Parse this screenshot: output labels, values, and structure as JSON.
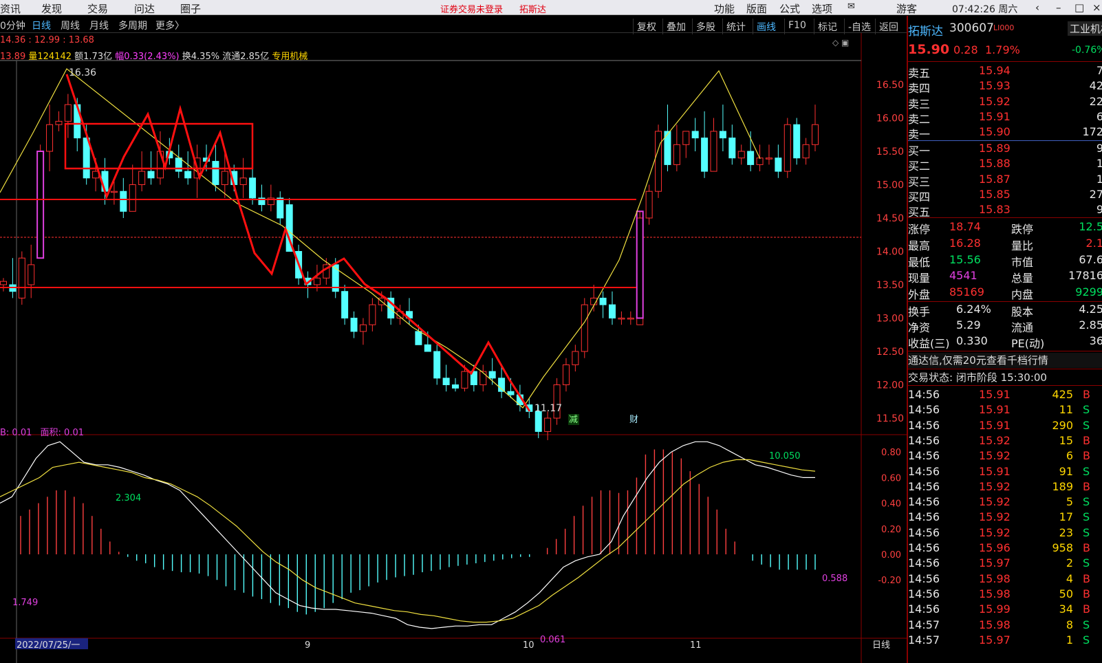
{
  "menubar": {
    "items": [
      "资讯",
      "发现",
      "交易",
      "问达",
      "圈子"
    ],
    "alert": "证券交易未登录",
    "alert_stock": "拓斯达",
    "right_items": [
      "功能",
      "版面",
      "公式",
      "选项"
    ],
    "guest": "游客",
    "time": "07:42:26 周六"
  },
  "toolbar": {
    "periods": [
      "0分钟",
      "日线",
      "周线",
      "月线",
      "多周期",
      "更多〉"
    ],
    "active_period": "日线",
    "right_buttons": [
      "复权",
      "叠加",
      "多股",
      "统计",
      "画线",
      "F10",
      "标记",
      "-自选",
      "返回"
    ],
    "active_button": "画线"
  },
  "info_line1": "14.36 : 12.99 : 13.68",
  "info_line2": {
    "a": "13.89",
    "vol": "量124142",
    "amt": "额1.73亿",
    "amp": "幅0.33(2.43%)",
    "turn": "换4.35%",
    "float": "流通2.85亿",
    "tag": "专用机械"
  },
  "annotations": {
    "high": "16.36",
    "low": "11.17",
    "mark_jian": "减",
    "mark_cai": "财"
  },
  "price_axis": [
    "16.50",
    "16.00",
    "15.50",
    "15.00",
    "14.50",
    "14.00",
    "13.50",
    "13.00",
    "12.50",
    "12.00",
    "11.50"
  ],
  "macd_header": {
    "b": "B: 0.01",
    "area": "面积: 0.01"
  },
  "macd_axis": [
    "0.80",
    "0.60",
    "0.40",
    "0.20",
    "0.00",
    "-0.20"
  ],
  "macd_labels": {
    "a": "2.304",
    "b": "1.749",
    "c": "10.050",
    "d": "0.588",
    "e": "0.061"
  },
  "date_axis": {
    "start": "2022/07/25/一",
    "m9": "9",
    "m10": "10",
    "m11": "11",
    "period": "日线"
  },
  "stock": {
    "name": "拓斯达",
    "code": "300607",
    "badge": "LI000",
    "sector": "工业机械",
    "sector_chg": "-0.76%",
    "price": "15.90",
    "chg": "0.28",
    "pct": "1.79%"
  },
  "asks": [
    {
      "label": "卖五",
      "price": "15.94",
      "vol": "7"
    },
    {
      "label": "卖四",
      "price": "15.93",
      "vol": "42"
    },
    {
      "label": "卖三",
      "price": "15.92",
      "vol": "22"
    },
    {
      "label": "卖二",
      "price": "15.91",
      "vol": "6"
    },
    {
      "label": "卖一",
      "price": "15.90",
      "vol": "172"
    }
  ],
  "bids": [
    {
      "label": "买一",
      "price": "15.89",
      "vol": "9"
    },
    {
      "label": "买二",
      "price": "15.88",
      "vol": "1"
    },
    {
      "label": "买三",
      "price": "15.87",
      "vol": "1"
    },
    {
      "label": "买四",
      "price": "15.85",
      "vol": "27"
    },
    {
      "label": "买五",
      "price": "15.83",
      "vol": "9"
    }
  ],
  "stats": [
    {
      "l1": "涨停",
      "v1": "18.74",
      "c1": "r",
      "l2": "跌停",
      "v2": "12.5",
      "c2": "g"
    },
    {
      "l1": "最高",
      "v1": "16.28",
      "c1": "r",
      "l2": "量比",
      "v2": "2.1",
      "c2": "r"
    },
    {
      "l1": "最低",
      "v1": "15.56",
      "c1": "g",
      "l2": "市值",
      "v2": "67.6",
      "c2": "w"
    },
    {
      "l1": "现量",
      "v1": "4541",
      "c1": "m",
      "l2": "总量",
      "v2": "17816",
      "c2": "w"
    },
    {
      "l1": "外盘",
      "v1": "85169",
      "c1": "r",
      "l2": "内盘",
      "v2": "9299",
      "c2": "g"
    }
  ],
  "stats2": [
    {
      "l1": "换手",
      "v1": "6.24%",
      "l2": "股本",
      "v2": "4.25"
    },
    {
      "l1": "净资",
      "v1": "5.29",
      "l2": "流通",
      "v2": "2.85"
    },
    {
      "l1": "收益(三)",
      "v1": "0.330",
      "l2": "PE(动)",
      "v2": "36"
    }
  ],
  "promo": "通达信,仅需20元查看千档行情",
  "trade_status": "交易状态: 闭市阶段 15:30:00",
  "ticks": [
    {
      "t": "14:56",
      "p": "15.91",
      "v": "425",
      "s": "B"
    },
    {
      "t": "14:56",
      "p": "15.91",
      "v": "11",
      "s": "S"
    },
    {
      "t": "14:56",
      "p": "15.91",
      "v": "290",
      "s": "S"
    },
    {
      "t": "14:56",
      "p": "15.92",
      "v": "15",
      "s": "B"
    },
    {
      "t": "14:56",
      "p": "15.92",
      "v": "6",
      "s": "B"
    },
    {
      "t": "14:56",
      "p": "15.91",
      "v": "91",
      "s": "S"
    },
    {
      "t": "14:56",
      "p": "15.92",
      "v": "189",
      "s": "B"
    },
    {
      "t": "14:56",
      "p": "15.92",
      "v": "5",
      "s": "S"
    },
    {
      "t": "14:56",
      "p": "15.92",
      "v": "17",
      "s": "S"
    },
    {
      "t": "14:56",
      "p": "15.92",
      "v": "23",
      "s": "S"
    },
    {
      "t": "14:56",
      "p": "15.96",
      "v": "958",
      "s": "B"
    },
    {
      "t": "14:56",
      "p": "15.97",
      "v": "2",
      "s": "S"
    },
    {
      "t": "14:56",
      "p": "15.98",
      "v": "4",
      "s": "B"
    },
    {
      "t": "14:56",
      "p": "15.98",
      "v": "50",
      "s": "B"
    },
    {
      "t": "14:56",
      "p": "15.99",
      "v": "34",
      "s": "B"
    },
    {
      "t": "14:57",
      "p": "15.98",
      "v": "8",
      "s": "S"
    },
    {
      "t": "14:57",
      "p": "15.97",
      "v": "1",
      "s": "S"
    }
  ],
  "chart_data": {
    "type": "candlestick",
    "ylim": [
      11.0,
      16.6
    ],
    "candles": [
      [
        13.5,
        13.6,
        13.4,
        13.55
      ],
      [
        13.5,
        13.9,
        13.3,
        13.4
      ],
      [
        13.3,
        14.0,
        13.2,
        13.9
      ],
      [
        13.5,
        14.1,
        13.3,
        13.8
      ],
      [
        13.9,
        15.6,
        13.9,
        15.5
      ],
      [
        15.5,
        16.2,
        15.2,
        15.9
      ],
      [
        15.9,
        16.1,
        15.8,
        15.95
      ],
      [
        15.95,
        16.36,
        15.7,
        16.2
      ],
      [
        16.2,
        16.3,
        15.5,
        15.7
      ],
      [
        15.7,
        15.9,
        15.0,
        15.1
      ],
      [
        15.1,
        15.4,
        14.9,
        15.2
      ],
      [
        15.2,
        15.4,
        14.7,
        14.9
      ],
      [
        14.9,
        15.1,
        14.7,
        14.9
      ],
      [
        14.9,
        15.1,
        14.5,
        14.6
      ],
      [
        14.6,
        15.3,
        14.6,
        15.0
      ],
      [
        15.0,
        15.5,
        14.9,
        15.2
      ],
      [
        15.2,
        15.5,
        15.0,
        15.1
      ],
      [
        15.1,
        15.8,
        15.0,
        15.5
      ],
      [
        15.5,
        15.7,
        15.3,
        15.4
      ],
      [
        15.4,
        15.6,
        15.1,
        15.2
      ],
      [
        15.2,
        15.5,
        15.0,
        15.1
      ],
      [
        15.1,
        15.6,
        14.8,
        15.4
      ],
      [
        15.4,
        15.6,
        15.2,
        15.35
      ],
      [
        15.35,
        15.6,
        14.9,
        15.0
      ],
      [
        15.0,
        15.5,
        14.8,
        15.2
      ],
      [
        15.2,
        15.3,
        14.9,
        15.0
      ],
      [
        15.0,
        15.4,
        14.8,
        15.1
      ],
      [
        15.1,
        15.3,
        14.7,
        14.8
      ],
      [
        14.8,
        15.0,
        14.6,
        14.7
      ],
      [
        14.7,
        15.0,
        14.6,
        14.8
      ],
      [
        14.8,
        14.9,
        14.4,
        14.5
      ],
      [
        14.7,
        14.8,
        14.0,
        14.0
      ],
      [
        14.0,
        14.1,
        13.5,
        13.6
      ],
      [
        13.6,
        13.7,
        13.3,
        13.5
      ],
      [
        13.5,
        13.8,
        13.4,
        13.6
      ],
      [
        13.6,
        13.9,
        13.5,
        13.8
      ],
      [
        13.8,
        13.9,
        13.3,
        13.4
      ],
      [
        13.4,
        13.5,
        12.9,
        13.0
      ],
      [
        13.0,
        13.1,
        12.7,
        12.8
      ],
      [
        12.8,
        13.0,
        12.6,
        12.9
      ],
      [
        12.9,
        13.3,
        12.8,
        13.2
      ],
      [
        13.2,
        13.4,
        13.1,
        13.3
      ],
      [
        13.3,
        13.4,
        12.9,
        13.0
      ],
      [
        13.0,
        13.2,
        12.9,
        13.1
      ],
      [
        13.1,
        13.3,
        12.9,
        13.0
      ],
      [
        12.8,
        12.9,
        12.6,
        12.6
      ],
      [
        12.6,
        12.8,
        12.5,
        12.5
      ],
      [
        12.5,
        12.6,
        12.0,
        12.1
      ],
      [
        12.1,
        12.3,
        11.9,
        12.0
      ],
      [
        12.0,
        12.1,
        11.9,
        11.95
      ],
      [
        11.95,
        12.3,
        11.9,
        12.2
      ],
      [
        12.2,
        12.3,
        11.9,
        12.0
      ],
      [
        12.0,
        12.3,
        11.9,
        12.2
      ],
      [
        12.2,
        12.4,
        12.0,
        12.1
      ],
      [
        12.1,
        12.3,
        11.8,
        11.9
      ],
      [
        11.9,
        12.1,
        11.8,
        11.85
      ],
      [
        11.85,
        12.0,
        11.6,
        11.7
      ],
      [
        11.7,
        11.8,
        11.5,
        11.6
      ],
      [
        11.6,
        11.7,
        11.2,
        11.3
      ],
      [
        11.3,
        11.6,
        11.17,
        11.5
      ],
      [
        11.5,
        12.1,
        11.4,
        12.0
      ],
      [
        12.0,
        12.4,
        11.9,
        12.3
      ],
      [
        12.3,
        12.6,
        12.2,
        12.5
      ],
      [
        12.5,
        13.3,
        12.4,
        13.2
      ],
      [
        13.2,
        13.5,
        13.1,
        13.3
      ],
      [
        13.3,
        13.4,
        13.0,
        13.2
      ],
      [
        13.2,
        13.4,
        12.9,
        13.0
      ],
      [
        13.0,
        13.1,
        12.9,
        13.0
      ],
      [
        13.0,
        13.1,
        12.9,
        13.0
      ],
      [
        12.9,
        14.6,
        12.9,
        14.5
      ],
      [
        14.5,
        15.0,
        14.4,
        14.9
      ],
      [
        14.9,
        15.9,
        14.8,
        15.8
      ],
      [
        15.8,
        16.2,
        15.2,
        15.3
      ],
      [
        15.3,
        15.9,
        15.2,
        15.6
      ],
      [
        15.6,
        15.8,
        15.4,
        15.8
      ],
      [
        15.8,
        16.0,
        15.5,
        15.7
      ],
      [
        15.7,
        16.1,
        15.1,
        15.2
      ],
      [
        15.2,
        16.0,
        15.2,
        15.8
      ],
      [
        15.8,
        16.2,
        15.5,
        15.7
      ],
      [
        15.7,
        15.9,
        15.3,
        15.4
      ],
      [
        15.4,
        15.6,
        15.3,
        15.5
      ],
      [
        15.5,
        15.8,
        15.2,
        15.3
      ],
      [
        15.3,
        15.6,
        15.2,
        15.4
      ],
      [
        15.4,
        15.6,
        15.3,
        15.4
      ],
      [
        15.4,
        15.6,
        15.1,
        15.2
      ],
      [
        15.2,
        16.0,
        15.1,
        15.9
      ],
      [
        15.9,
        16.0,
        15.3,
        15.4
      ],
      [
        15.4,
        15.7,
        15.3,
        15.6
      ],
      [
        15.6,
        16.2,
        15.5,
        15.9
      ]
    ],
    "macd_hist": [
      0.3,
      0.35,
      0.4,
      0.45,
      0.5,
      0.5,
      0.45,
      0.4,
      0.3,
      0.2,
      0.1,
      0.02,
      -0.02,
      -0.05,
      -0.07,
      -0.1,
      -0.12,
      -0.13,
      -0.14,
      -0.14,
      -0.15,
      -0.17,
      -0.2,
      -0.25,
      -0.28,
      -0.3,
      -0.33,
      -0.35,
      -0.38,
      -0.4,
      -0.42,
      -0.45,
      -0.47,
      -0.45,
      -0.42,
      -0.38,
      -0.35,
      -0.3,
      -0.28,
      -0.25,
      -0.22,
      -0.2,
      -0.18,
      -0.17,
      -0.16,
      -0.14,
      -0.13,
      -0.12,
      -0.1,
      -0.09,
      -0.08,
      -0.07,
      -0.06,
      -0.05,
      -0.04,
      -0.03,
      -0.02,
      -0.02,
      0.0,
      0.05,
      0.12,
      0.2,
      0.3,
      0.38,
      0.45,
      0.5,
      0.5,
      0.48,
      0.5,
      0.6,
      0.78,
      0.82,
      0.82,
      0.8,
      0.75,
      0.65,
      0.55,
      0.45,
      0.35,
      0.2,
      0.1,
      0.0,
      -0.05,
      -0.08,
      -0.1,
      -0.12,
      -0.12,
      -0.12,
      -0.12,
      -0.12
    ],
    "dif": [
      0.4,
      0.45,
      0.6,
      0.75,
      0.85,
      0.88,
      0.8,
      0.72,
      0.7,
      0.7,
      0.68,
      0.65,
      0.62,
      0.58,
      0.55,
      0.5,
      0.4,
      0.3,
      0.2,
      0.1,
      0.0,
      -0.1,
      -0.2,
      -0.3,
      -0.35,
      -0.4,
      -0.42,
      -0.43,
      -0.43,
      -0.44,
      -0.45,
      -0.46,
      -0.48,
      -0.5,
      -0.55,
      -0.57,
      -0.58,
      -0.57,
      -0.56,
      -0.56,
      -0.55,
      -0.55,
      -0.5,
      -0.45,
      -0.38,
      -0.3,
      -0.2,
      -0.1,
      -0.05,
      -0.02,
      0.0,
      0.1,
      0.3,
      0.45,
      0.6,
      0.72,
      0.8,
      0.85,
      0.88,
      0.88,
      0.85,
      0.8,
      0.75,
      0.7,
      0.68,
      0.65,
      0.62,
      0.6,
      0.6
    ],
    "dea": [
      0.45,
      0.5,
      0.55,
      0.6,
      0.68,
      0.7,
      0.72,
      0.7,
      0.68,
      0.66,
      0.64,
      0.6,
      0.58,
      0.55,
      0.5,
      0.45,
      0.38,
      0.3,
      0.22,
      0.12,
      0.02,
      -0.06,
      -0.12,
      -0.2,
      -0.26,
      -0.3,
      -0.34,
      -0.38,
      -0.4,
      -0.42,
      -0.44,
      -0.45,
      -0.47,
      -0.48,
      -0.5,
      -0.52,
      -0.53,
      -0.53,
      -0.52,
      -0.5,
      -0.45,
      -0.4,
      -0.32,
      -0.25,
      -0.18,
      -0.1,
      -0.02,
      0.05,
      0.15,
      0.25,
      0.35,
      0.45,
      0.55,
      0.62,
      0.68,
      0.72,
      0.74,
      0.74,
      0.72,
      0.7,
      0.68,
      0.66,
      0.65
    ]
  }
}
